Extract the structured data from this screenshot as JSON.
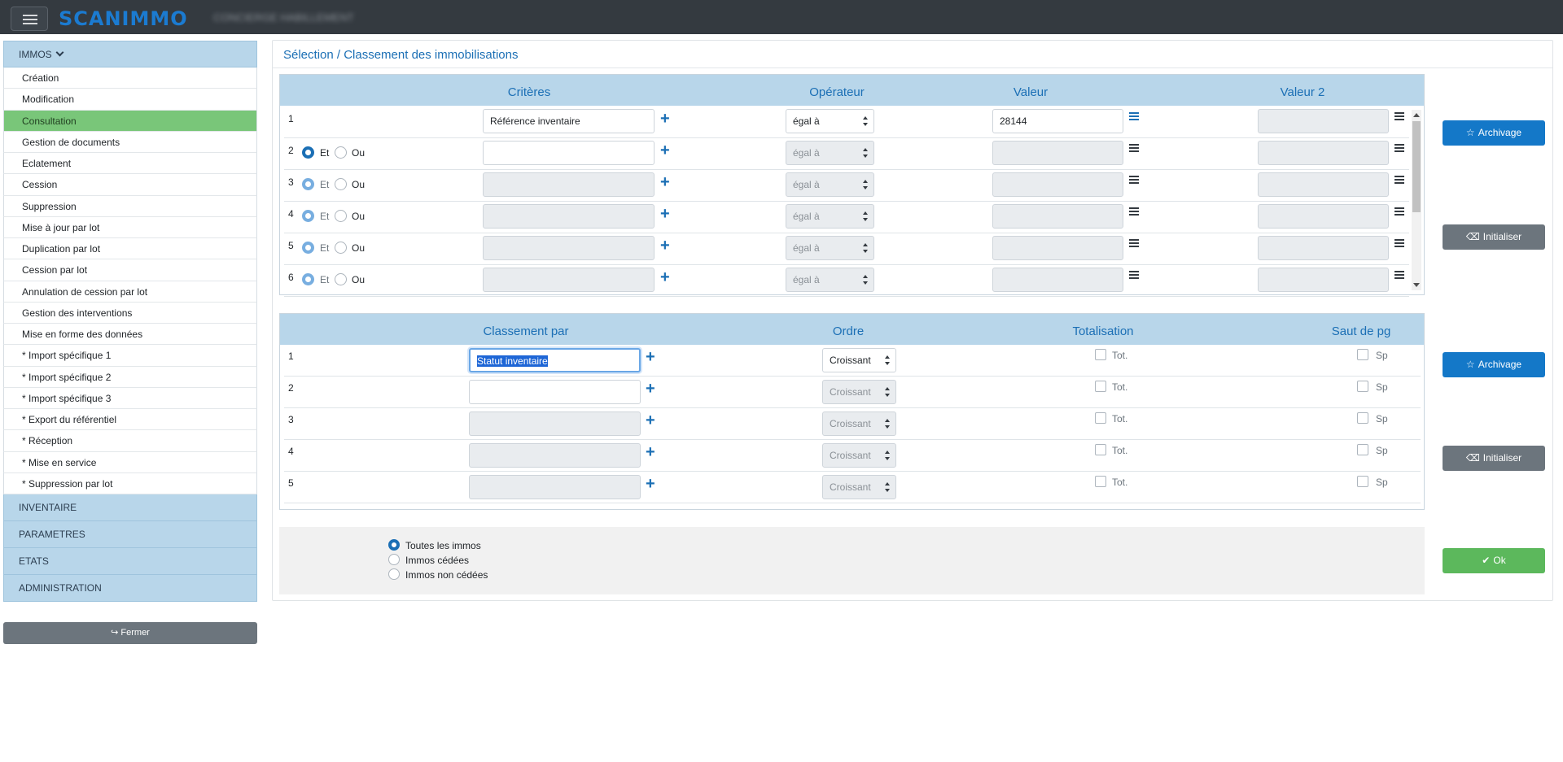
{
  "header": {
    "logo": "SCANIMMO",
    "company": "CONCIERGE HABILLEMENT"
  },
  "sidebar": {
    "section_title": "IMMOS",
    "items": [
      {
        "label": "Création"
      },
      {
        "label": "Modification"
      },
      {
        "label": "Consultation",
        "active": true
      },
      {
        "label": "Gestion de documents"
      },
      {
        "label": "Eclatement"
      },
      {
        "label": "Cession"
      },
      {
        "label": "Suppression"
      },
      {
        "label": "Mise à jour par lot"
      },
      {
        "label": "Duplication par lot"
      },
      {
        "label": "Cession par lot"
      },
      {
        "label": "Annulation de cession par lot"
      },
      {
        "label": "Gestion des interventions"
      },
      {
        "label": "Mise en forme des données"
      },
      {
        "label": "* Import spécifique 1"
      },
      {
        "label": "* Import spécifique 2"
      },
      {
        "label": "* Import spécifique 3"
      },
      {
        "label": "* Export du référentiel"
      },
      {
        "label": "* Réception"
      },
      {
        "label": "* Mise en service"
      },
      {
        "label": "* Suppression par lot"
      }
    ],
    "groups": [
      "INVENTAIRE",
      "PARAMETRES",
      "ETATS",
      "ADMINISTRATION"
    ],
    "close_label": "Fermer"
  },
  "page": {
    "title": "Sélection / Classement des immobilisations"
  },
  "criteria": {
    "headers": {
      "criteria": "Critères",
      "operator": "Opérateur",
      "value": "Valeur",
      "value2": "Valeur 2"
    },
    "and_label": "Et",
    "or_label": "Ou",
    "operator_default": "égal à",
    "rows": [
      {
        "num": "1",
        "criteria": "Référence inventaire",
        "operator": "égal à",
        "value": "28144",
        "value2": ""
      },
      {
        "num": "2",
        "criteria": "",
        "operator": "égal à",
        "value": "",
        "value2": ""
      },
      {
        "num": "3",
        "criteria": "",
        "operator": "égal à",
        "value": "",
        "value2": ""
      },
      {
        "num": "4",
        "criteria": "",
        "operator": "égal à",
        "value": "",
        "value2": ""
      },
      {
        "num": "5",
        "criteria": "",
        "operator": "égal à",
        "value": "",
        "value2": ""
      },
      {
        "num": "6",
        "criteria": "",
        "operator": "égal à",
        "value": "",
        "value2": ""
      }
    ]
  },
  "sorting": {
    "headers": {
      "sort_by": "Classement par",
      "order": "Ordre",
      "total": "Totalisation",
      "page_break": "Saut de pg"
    },
    "total_label": "Tot.",
    "break_label": "Sp",
    "rows": [
      {
        "num": "1",
        "sort_by": "Statut inventaire",
        "order": "Croissant"
      },
      {
        "num": "2",
        "sort_by": "",
        "order": "Croissant"
      },
      {
        "num": "3",
        "sort_by": "",
        "order": "Croissant"
      },
      {
        "num": "4",
        "sort_by": "",
        "order": "Croissant"
      },
      {
        "num": "5",
        "sort_by": "",
        "order": "Croissant"
      }
    ]
  },
  "filters": {
    "options": [
      "Toutes les immos",
      "Immos cédées",
      "Immos non cédées"
    ],
    "selected": "Toutes les immos"
  },
  "buttons": {
    "archive": "Archivage",
    "reset": "Initialiser",
    "ok": "Ok"
  },
  "colors": {
    "accent": "#1b6fb5",
    "header_bg": "#b8d6ea",
    "active_menu": "#79c679",
    "ok": "#5cb85c",
    "topbar": "#343a40"
  }
}
